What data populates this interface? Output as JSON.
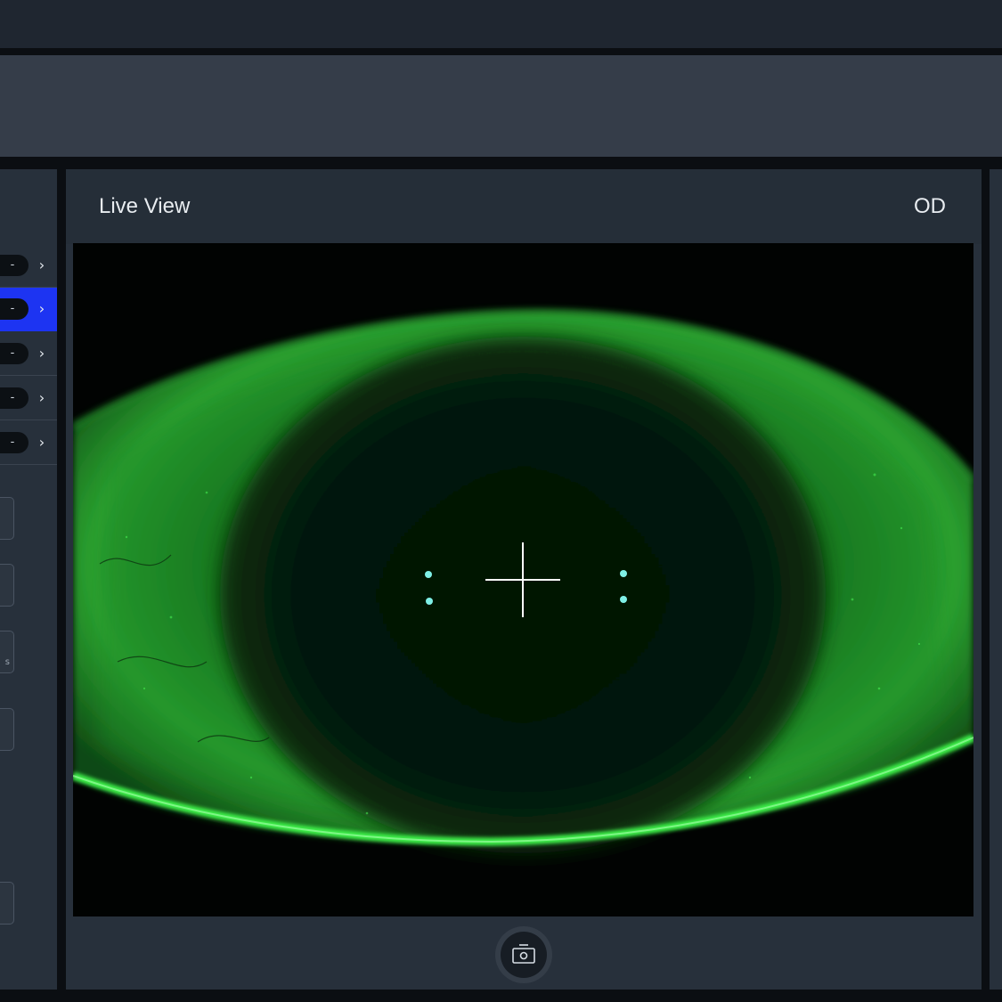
{
  "main": {
    "title": "Live View",
    "eye": "OD"
  },
  "sidebar": {
    "params": [
      {
        "value": "-",
        "active": false
      },
      {
        "value": "-",
        "active": true
      },
      {
        "value": "-",
        "active": false
      },
      {
        "value": "-",
        "active": false
      },
      {
        "value": "-",
        "active": false
      }
    ],
    "buttons": [
      {
        "label": ""
      },
      {
        "label": ""
      },
      {
        "label": "s"
      },
      {
        "label": ""
      },
      {
        "label": ""
      }
    ]
  },
  "capture": {
    "icon": "camera-icon"
  },
  "colors": {
    "accent": "#1d34f2",
    "fluorescein": "#32e03c",
    "reticle": "#ffffff",
    "alignment_dots": "#7ff0e6"
  }
}
